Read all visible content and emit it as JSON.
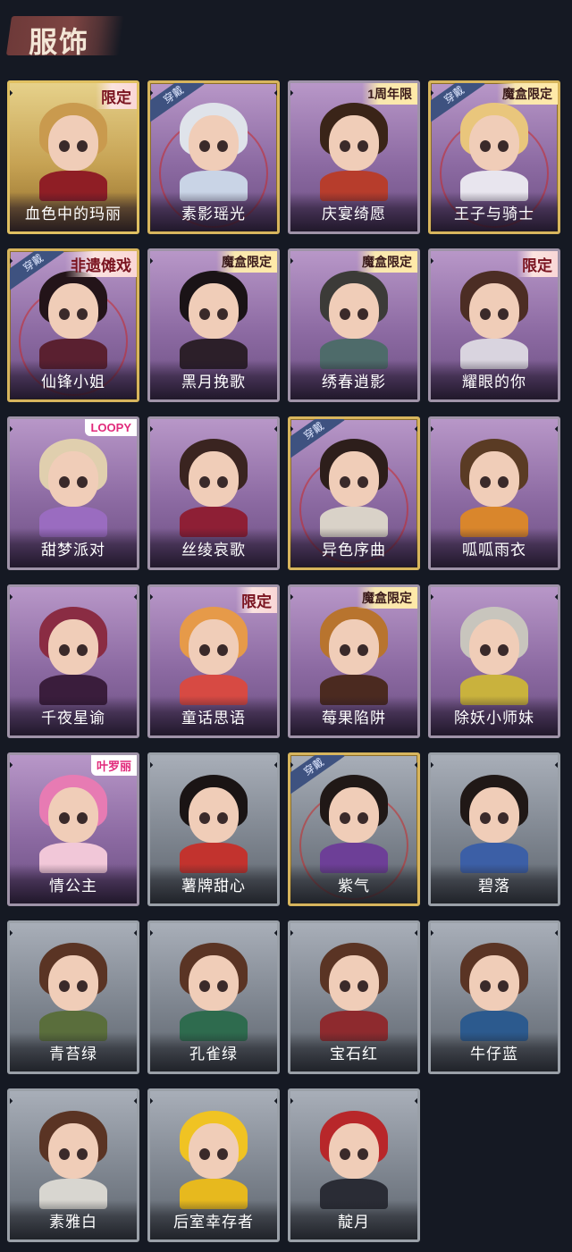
{
  "header": {
    "title": "服饰"
  },
  "colors": {
    "background": "#151923",
    "accent": "#7d4442",
    "wear_tag": "#3e5280"
  },
  "costumes": [
    {
      "name": "血色中的玛丽",
      "badge": "限定",
      "badge_kind": "limited",
      "worn": false,
      "style": "goldbg",
      "hair": "#c99a4e",
      "outfit": "#8f1e25"
    },
    {
      "name": "素影瑶光",
      "badge": "",
      "badge_kind": "",
      "worn": true,
      "style": "purple gold",
      "hair": "#dfe3ea",
      "outfit": "#c9d4e6"
    },
    {
      "name": "庆宴绮愿",
      "badge": "1周年限",
      "badge_kind": "normal",
      "worn": false,
      "style": "purple",
      "hair": "#3a2418",
      "outfit": "#b73d2c"
    },
    {
      "name": "王子与骑士",
      "badge": "魔盒限定",
      "badge_kind": "normal",
      "worn": true,
      "style": "purple gold",
      "hair": "#e9c67c",
      "outfit": "#e8e5ee"
    },
    {
      "name": "仙锋小姐",
      "badge": "非遗傩戏",
      "badge_kind": "limited",
      "worn": true,
      "style": "purple gold",
      "hair": "#231419",
      "outfit": "#5a2030"
    },
    {
      "name": "黑月挽歌",
      "badge": "魔盒限定",
      "badge_kind": "normal",
      "worn": false,
      "style": "purple",
      "hair": "#1a1316",
      "outfit": "#2c1f29"
    },
    {
      "name": "绣春逍影",
      "badge": "魔盒限定",
      "badge_kind": "normal",
      "worn": false,
      "style": "purple",
      "hair": "#3c3b38",
      "outfit": "#4e6b6a"
    },
    {
      "name": "耀眼的你",
      "badge": "限定",
      "badge_kind": "limited",
      "worn": false,
      "style": "purple",
      "hair": "#4c2d24",
      "outfit": "#d9d4df"
    },
    {
      "name": "甜梦派对",
      "badge": "LOOPY",
      "badge_kind": "logo",
      "worn": false,
      "style": "purple",
      "hair": "#e0cfae",
      "outfit": "#9a6cc0"
    },
    {
      "name": "丝绫哀歌",
      "badge": "",
      "badge_kind": "",
      "worn": false,
      "style": "purple",
      "hair": "#3a2420",
      "outfit": "#8e1f35"
    },
    {
      "name": "异色序曲",
      "badge": "",
      "badge_kind": "",
      "worn": true,
      "style": "purple gold",
      "hair": "#2d1e1b",
      "outfit": "#d9d2c8"
    },
    {
      "name": "呱呱雨衣",
      "badge": "",
      "badge_kind": "",
      "worn": false,
      "style": "purple",
      "hair": "#5a3b24",
      "outfit": "#d9862c"
    },
    {
      "name": "千夜星谕",
      "badge": "",
      "badge_kind": "",
      "worn": false,
      "style": "purple",
      "hair": "#8a2c43",
      "outfit": "#3a1d3c"
    },
    {
      "name": "童话思语",
      "badge": "限定",
      "badge_kind": "limited",
      "worn": false,
      "style": "purple",
      "hair": "#e69a49",
      "outfit": "#d74a43"
    },
    {
      "name": "莓果陷阱",
      "badge": "魔盒限定",
      "badge_kind": "normal",
      "worn": false,
      "style": "purple",
      "hair": "#b8742e",
      "outfit": "#4b2a20"
    },
    {
      "name": "除妖小师妹",
      "badge": "",
      "badge_kind": "",
      "worn": false,
      "style": "purple",
      "hair": "#c8c5bd",
      "outfit": "#c9b23d"
    },
    {
      "name": "情公主",
      "badge": "叶罗丽",
      "badge_kind": "logo",
      "worn": false,
      "style": "purple",
      "hair": "#e77bb3",
      "outfit": "#f1c7d8"
    },
    {
      "name": "薯牌甜心",
      "badge": "",
      "badge_kind": "",
      "worn": false,
      "style": "gray",
      "hair": "#1a1414",
      "outfit": "#c2332e"
    },
    {
      "name": "紫气",
      "badge": "",
      "badge_kind": "",
      "worn": true,
      "style": "gray gold",
      "hair": "#201816",
      "outfit": "#6d3f97"
    },
    {
      "name": "碧落",
      "badge": "",
      "badge_kind": "",
      "worn": false,
      "style": "gray",
      "hair": "#201816",
      "outfit": "#3c5fa6"
    },
    {
      "name": "青苔绿",
      "badge": "",
      "badge_kind": "",
      "worn": false,
      "style": "gray",
      "hair": "#5a3424",
      "outfit": "#5a6e3c"
    },
    {
      "name": "孔雀绿",
      "badge": "",
      "badge_kind": "",
      "worn": false,
      "style": "gray",
      "hair": "#5a3424",
      "outfit": "#2e6b4e"
    },
    {
      "name": "宝石红",
      "badge": "",
      "badge_kind": "",
      "worn": false,
      "style": "gray",
      "hair": "#5a3424",
      "outfit": "#8e2a2e"
    },
    {
      "name": "牛仔蓝",
      "badge": "",
      "badge_kind": "",
      "worn": false,
      "style": "gray",
      "hair": "#5a3424",
      "outfit": "#2c5a8e"
    },
    {
      "name": "素雅白",
      "badge": "",
      "badge_kind": "",
      "worn": false,
      "style": "gray",
      "hair": "#5a3424",
      "outfit": "#d8d6d0"
    },
    {
      "name": "后室幸存者",
      "badge": "",
      "badge_kind": "",
      "worn": false,
      "style": "gray",
      "hair": "#f0c323",
      "outfit": "#e7b91e"
    },
    {
      "name": "靛月",
      "badge": "",
      "badge_kind": "",
      "worn": false,
      "style": "gray",
      "hair": "#b8272a",
      "outfit": "#2a2c35"
    }
  ],
  "wear_label": "穿戴"
}
